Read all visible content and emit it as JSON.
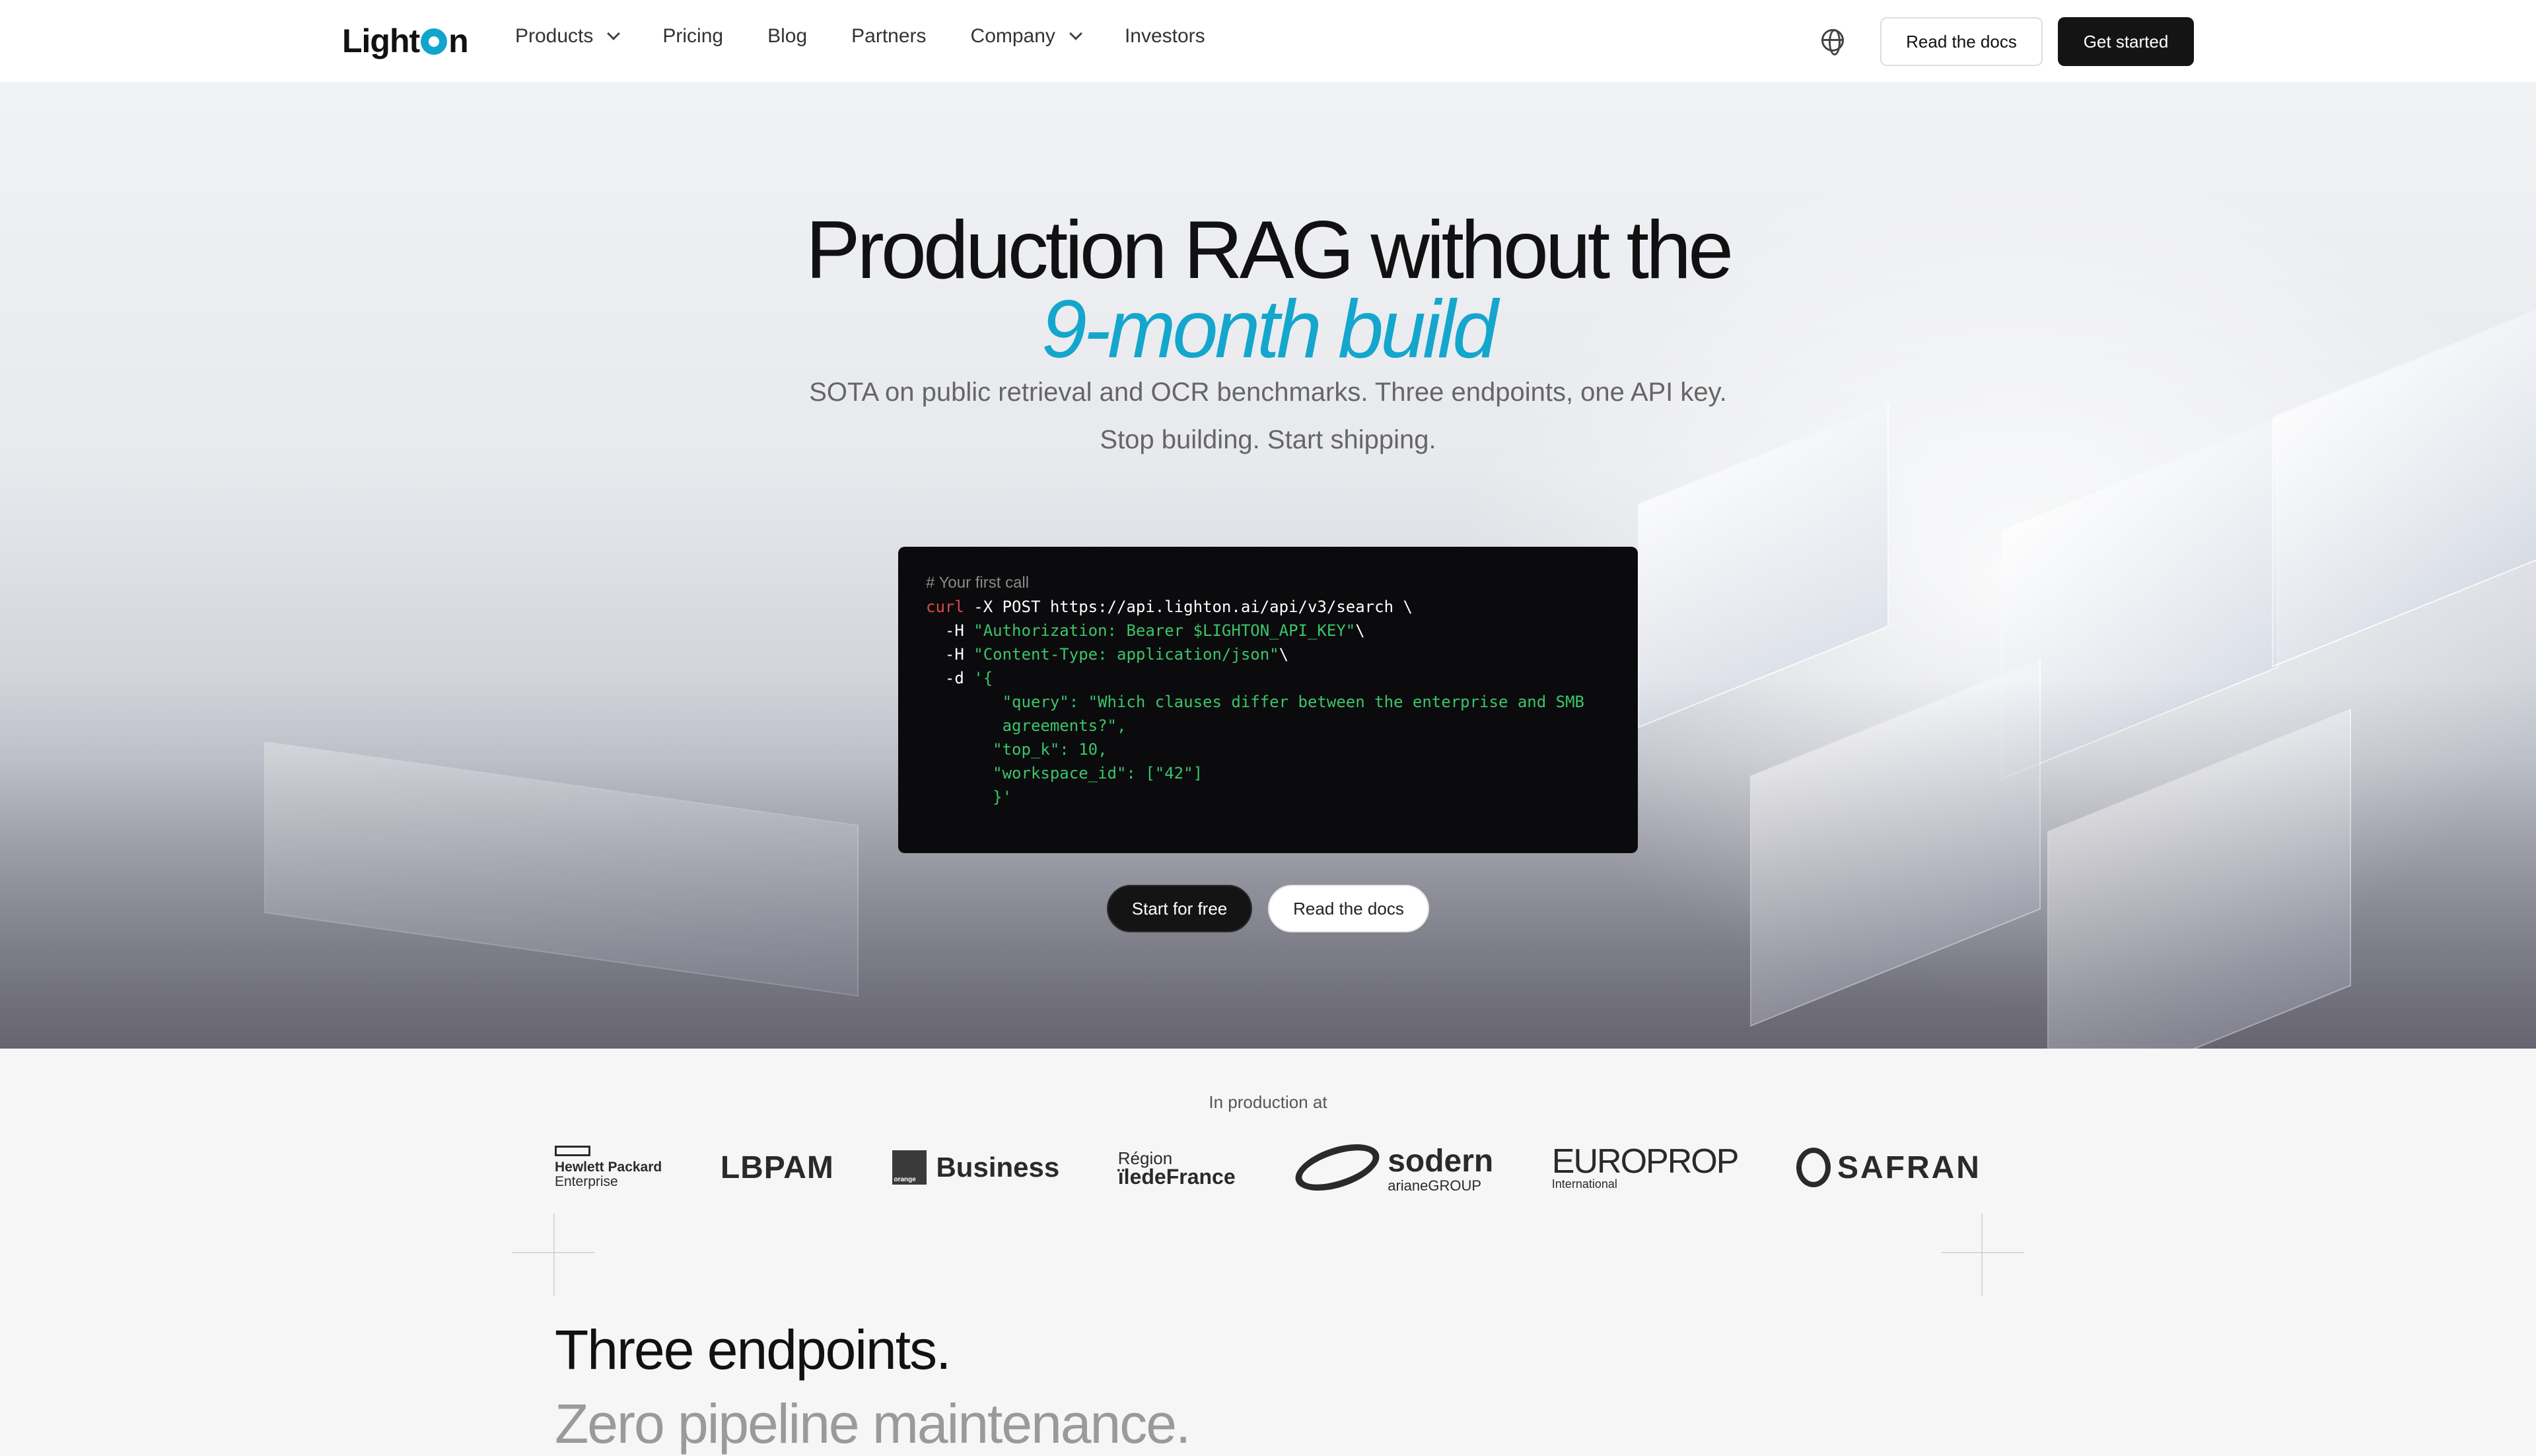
{
  "nav": {
    "logo": "LightOn",
    "items": [
      {
        "label": "Products",
        "has_dropdown": true
      },
      {
        "label": "Pricing",
        "has_dropdown": false
      },
      {
        "label": "Blog",
        "has_dropdown": false
      },
      {
        "label": "Partners",
        "has_dropdown": false
      },
      {
        "label": "Company",
        "has_dropdown": true
      },
      {
        "label": "Investors",
        "has_dropdown": false
      }
    ],
    "language_icon": "globe-icon",
    "read_docs_label": "Read the docs",
    "get_started_label": "Get started"
  },
  "hero": {
    "title_line1": "Production RAG without the",
    "title_line2": "9-month build",
    "subtitle_line1": "SOTA on public retrieval and OCR benchmarks. Three endpoints, one API key.",
    "subtitle_line2": "Stop building. Start shipping.",
    "code": {
      "comment": "# Your first call",
      "cmd": "curl",
      "line1": " -X POST https://api.lighton.ai/api/v3/search \\",
      "h1_flag": "  -H ",
      "h1_val": "\"Authorization: Bearer $LIGHTON_API_KEY\"",
      "h1_end": "\\",
      "h2_flag": "  -H ",
      "h2_val": "\"Content-Type: application/json\"",
      "h2_end": "\\",
      "d_flag": "  -d ",
      "d_open": "'{",
      "q1": "        \"query\": \"Which clauses differ between the enterprise and SMB",
      "q2": "        agreements?\",",
      "topk": "       \"top_k\": 10,",
      "ws": "       \"workspace_id\": [\"42\"]",
      "close": "       }'"
    },
    "start_free_label": "Start for free",
    "read_docs_label": "Read the docs",
    "accent_color": "#14a6cd"
  },
  "customers": {
    "label": "In production at",
    "logos": [
      {
        "name": "Hewlett Packard",
        "sub": "Enterprise"
      },
      {
        "name": "LBPAM"
      },
      {
        "name": "Business",
        "badge": "orange"
      },
      {
        "name_small": "Région",
        "name": "ïledeFrance"
      },
      {
        "name": "sodern",
        "sub": "arianeGROUP"
      },
      {
        "name": "EUROPROP",
        "sub": "International"
      },
      {
        "name": "SAFRAN"
      }
    ]
  },
  "section": {
    "title": "Three endpoints.",
    "subtitle": "Zero pipeline maintenance."
  }
}
